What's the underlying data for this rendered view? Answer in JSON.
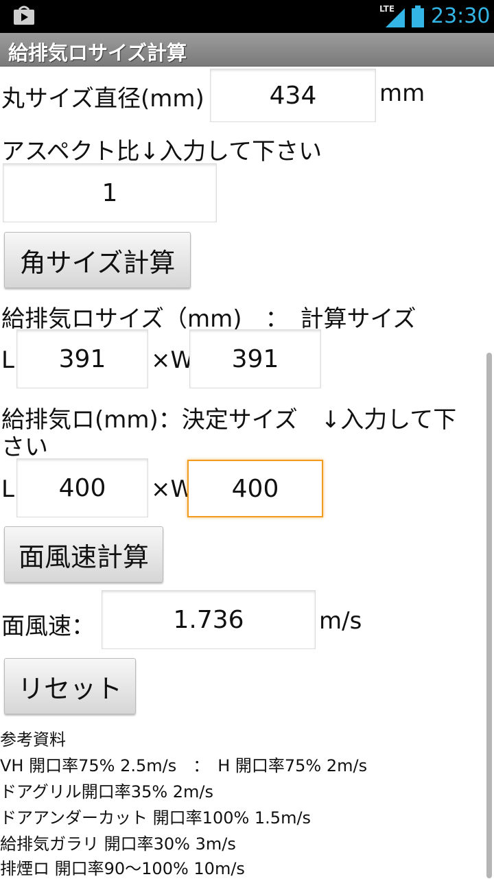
{
  "status_bar": {
    "network": "LTE",
    "time": "23:30",
    "icons": [
      "play-store-icon",
      "signal-icon",
      "battery-icon"
    ]
  },
  "app": {
    "title": "給排気ロサイズ計算"
  },
  "round_size": {
    "label": "丸サイズ直径(mm)",
    "value": "434",
    "unit": "mm"
  },
  "aspect": {
    "label": "アスペクト比↓入力して下さい",
    "value": "1"
  },
  "buttons": {
    "square_calc": "角サイズ計算",
    "face_velocity_calc": "面風速計算",
    "reset": "リセット"
  },
  "calc_size": {
    "label": "給排気ロサイズ（mm)　：　計算サイズ",
    "l_label": "L",
    "l_value": "391",
    "w_label": "×W",
    "w_value": "391"
  },
  "decided_size": {
    "label_line1": "給排気ロ(mm)：決定サイズ　↓入力して下",
    "label_line2": "さい",
    "l_label": "L",
    "l_value": "400",
    "w_label": "×W",
    "w_value": "400"
  },
  "face_velocity": {
    "label": "面風速：",
    "value": "1.736",
    "unit": "m/s"
  },
  "reference": {
    "heading": "参考資料",
    "lines": [
      "VH 開口率75% 2.5m/s　：　H 開口率75% 2m/s",
      "ドアグリル開口率35% 2m/s",
      "ドアアンダーカット 開口率100% 1.5m/s",
      "給排気ガラリ 開口率30% 3m/s",
      "排煙ロ 開口率90～100% 10m/s"
    ]
  },
  "colors": {
    "accent": "#33b5e5",
    "focus": "#f39b1e",
    "title_bar": "#8a8a8a"
  }
}
